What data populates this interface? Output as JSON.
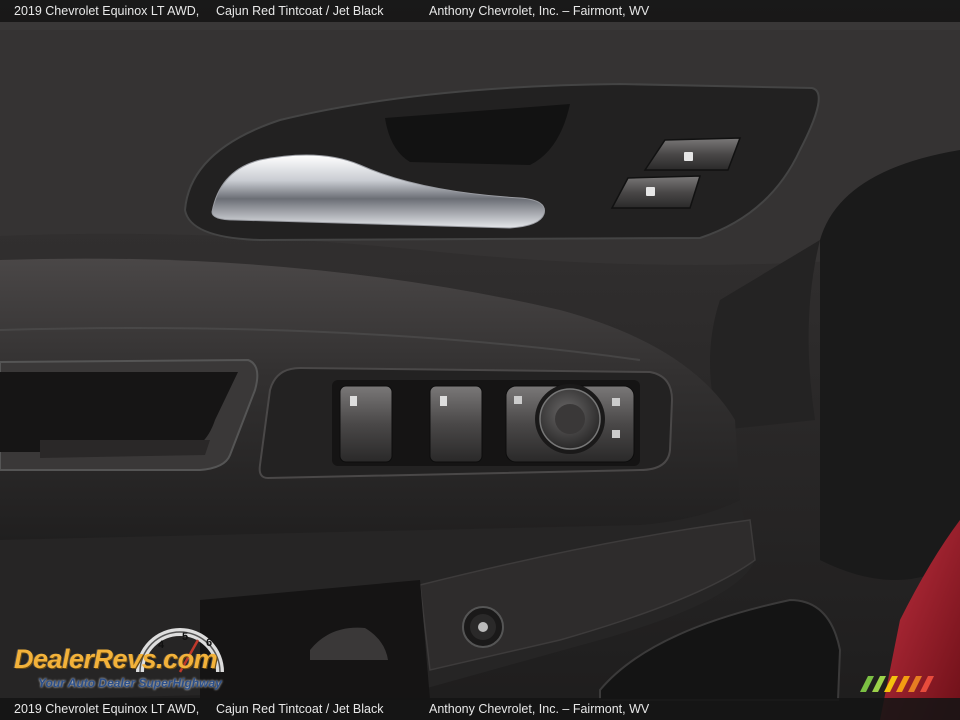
{
  "caption": {
    "vehicle": "2019 Chevrolet Equinox LT AWD,",
    "color": "Cajun Red Tintcoat / Jet Black",
    "dealer": "Anthony Chevrolet, Inc.  –  Fairmont, WV"
  },
  "watermark": {
    "logo_text": "DealerRevs.com",
    "tagline": "Your Auto Dealer SuperHighway",
    "gauge_numbers": [
      "4",
      "5",
      "6"
    ]
  },
  "colors": {
    "door_panel": "#2c2a2a",
    "trim_chrome": "#d6d8dc",
    "body_paint": "#9b1c2a",
    "logo_gold": "#f3b23a",
    "logo_blue": "#2b4f8a"
  }
}
